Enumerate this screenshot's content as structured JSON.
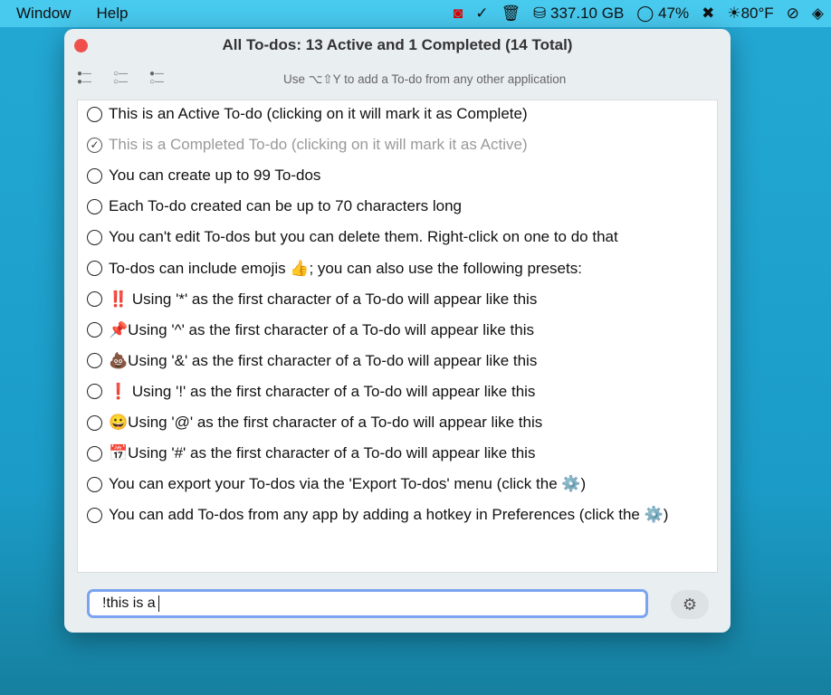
{
  "menubar": {
    "items": [
      "Window",
      "Help"
    ],
    "disk": "337.10 GB",
    "battery": "47%",
    "weather": "80°F"
  },
  "window": {
    "title": "All To-dos: 13 Active and 1 Completed (14 Total)",
    "hint": "Use ⌥⇧Y to add a To-do from any other application"
  },
  "todos": [
    {
      "text": "This is an Active To-do (clicking on it will mark it as Complete)",
      "done": false
    },
    {
      "text": "This is a Completed To-do (clicking on it will mark it as Active)",
      "done": true
    },
    {
      "text": "You can create up to 99 To-dos",
      "done": false
    },
    {
      "text": "Each To-do created can be up to 70 characters long",
      "done": false
    },
    {
      "text": "You can't edit To-dos but you can delete them. Right-click on one to do that",
      "done": false
    },
    {
      "text": "To-dos can include emojis 👍; you can also use the following presets:",
      "done": false
    },
    {
      "text": "‼️ Using '*' as the first character of a To-do will appear like this",
      "done": false
    },
    {
      "text": "📌Using '^' as the first character of a To-do will appear like this",
      "done": false
    },
    {
      "text": "💩Using '&' as the first character of a To-do will appear like this",
      "done": false
    },
    {
      "text": "❗ Using '!' as the first character of a To-do will appear like this",
      "done": false
    },
    {
      "text": "😀Using '@' as the first character of a To-do will appear like this",
      "done": false
    },
    {
      "text": "📅Using '#' as the first character of a To-do will appear like this",
      "done": false
    },
    {
      "text": "You can export your To-dos via the 'Export To-dos' menu (click the ⚙️)",
      "done": false
    },
    {
      "text": "You can add To-dos from any app by adding a hotkey in Preferences (click the ⚙️)",
      "done": false
    }
  ],
  "input": {
    "value": "!this is a"
  }
}
